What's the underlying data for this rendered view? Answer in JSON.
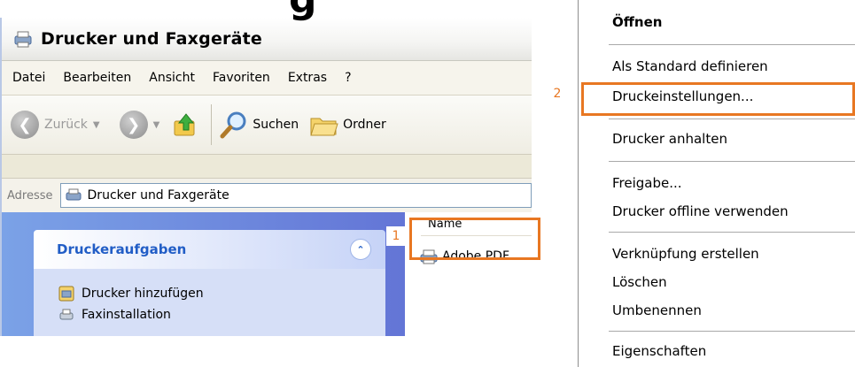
{
  "window": {
    "title": "Drucker und Faxgeräte",
    "menu": [
      "Datei",
      "Bearbeiten",
      "Ansicht",
      "Favoriten",
      "Extras",
      "?"
    ],
    "toolbar": {
      "back": "Zurück",
      "search": "Suchen",
      "folders": "Ordner"
    },
    "address": {
      "label": "Adresse",
      "value": "Drucker und Faxgeräte"
    },
    "tasks": {
      "header": "Druckeraufgaben",
      "items": [
        "Drucker hinzufügen",
        "Faxinstallation"
      ]
    },
    "file_list": {
      "column": "Name",
      "items": [
        "Adobe PDF"
      ]
    }
  },
  "callouts": {
    "step1": "1",
    "step2": "2"
  },
  "context_menu": {
    "items": [
      "Öffnen",
      "Als Standard definieren",
      "Druckeinstellungen...",
      "Drucker anhalten",
      "Freigabe...",
      "Drucker offline verwenden",
      "Verknüpfung erstellen",
      "Löschen",
      "Umbenennen",
      "Eigenschaften"
    ]
  },
  "colors": {
    "highlight": "#e87722",
    "taskpane": "#6375d6",
    "task_header_text": "#215dc6"
  }
}
